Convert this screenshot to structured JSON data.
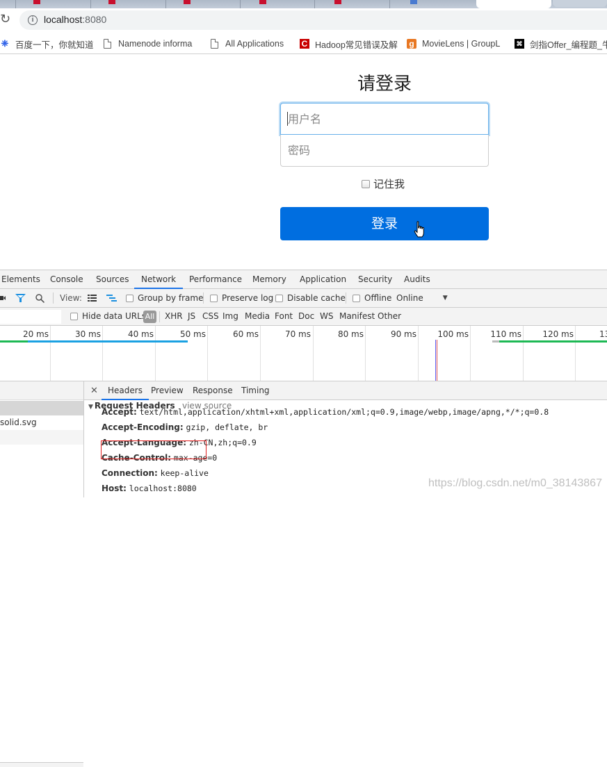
{
  "browser": {
    "url_host": "localhost",
    "url_port": ":8080",
    "reload_icon": "reload-icon",
    "info_icon": "info-icon",
    "bookmarks": [
      {
        "label": "百度一下，你就知道",
        "icon": "baidu-paw-icon"
      },
      {
        "label": "Namenode informa",
        "icon": "page-icon"
      },
      {
        "label": "All Applications",
        "icon": "page-icon"
      },
      {
        "label": "Hadoop常见错误及解",
        "icon": "csdn-c-icon"
      },
      {
        "label": "MovieLens | GroupL",
        "icon": "grouplens-g-icon"
      },
      {
        "label": "剑指Offer_编程题_牛",
        "icon": "nowcoder-icon"
      }
    ]
  },
  "page": {
    "title": "请登录",
    "username_placeholder": "用户名",
    "username_value": "",
    "password_placeholder": "密码",
    "password_value": "",
    "remember_label": "记住我",
    "remember_checked": false,
    "login_button": "登录",
    "accent_color": "#006ee0"
  },
  "devtools": {
    "tabs": [
      "Elements",
      "Console",
      "Sources",
      "Network",
      "Performance",
      "Memory",
      "Application",
      "Security",
      "Audits"
    ],
    "active_tab": "Network",
    "toolbar": {
      "view_label": "View:",
      "group_by_frame": "Group by frame",
      "preserve_log": "Preserve log",
      "disable_cache": "Disable cache",
      "offline": "Offline",
      "throttling": "Online"
    },
    "filter": {
      "hide_data_urls": "Hide data URLs",
      "types": [
        "All",
        "XHR",
        "JS",
        "CSS",
        "Img",
        "Media",
        "Font",
        "Doc",
        "WS",
        "Manifest",
        "Other"
      ],
      "active_type": "All"
    },
    "timeline": {
      "ticks": [
        "20 ms",
        "30 ms",
        "40 ms",
        "50 ms",
        "60 ms",
        "70 ms",
        "80 ms",
        "90 ms",
        "100 ms",
        "110 ms",
        "120 ms",
        "13"
      ]
    },
    "requests": [
      {
        "name": "",
        "selected": true
      },
      {
        "name": "solid.svg",
        "selected": false
      },
      {
        "name": "",
        "selected": false
      }
    ],
    "detail_tabs": [
      "Headers",
      "Preview",
      "Response",
      "Timing"
    ],
    "active_detail_tab": "Headers",
    "request_headers_title": "Request Headers",
    "view_source": "view source",
    "headers": [
      {
        "key": "Accept:",
        "value": "text/html,application/xhtml+xml,application/xml;q=0.9,image/webp,image/apng,*/*;q=0.8"
      },
      {
        "key": "Accept-Encoding:",
        "value": "gzip, deflate, br"
      },
      {
        "key": "Accept-Language:",
        "value": "zh-CN,zh;q=0.9"
      },
      {
        "key": "Cache-Control:",
        "value": "max-age=0"
      },
      {
        "key": "Connection:",
        "value": "keep-alive"
      },
      {
        "key": "Host:",
        "value": "localhost:8080"
      }
    ]
  },
  "watermark": "https://blog.csdn.net/m0_38143867"
}
